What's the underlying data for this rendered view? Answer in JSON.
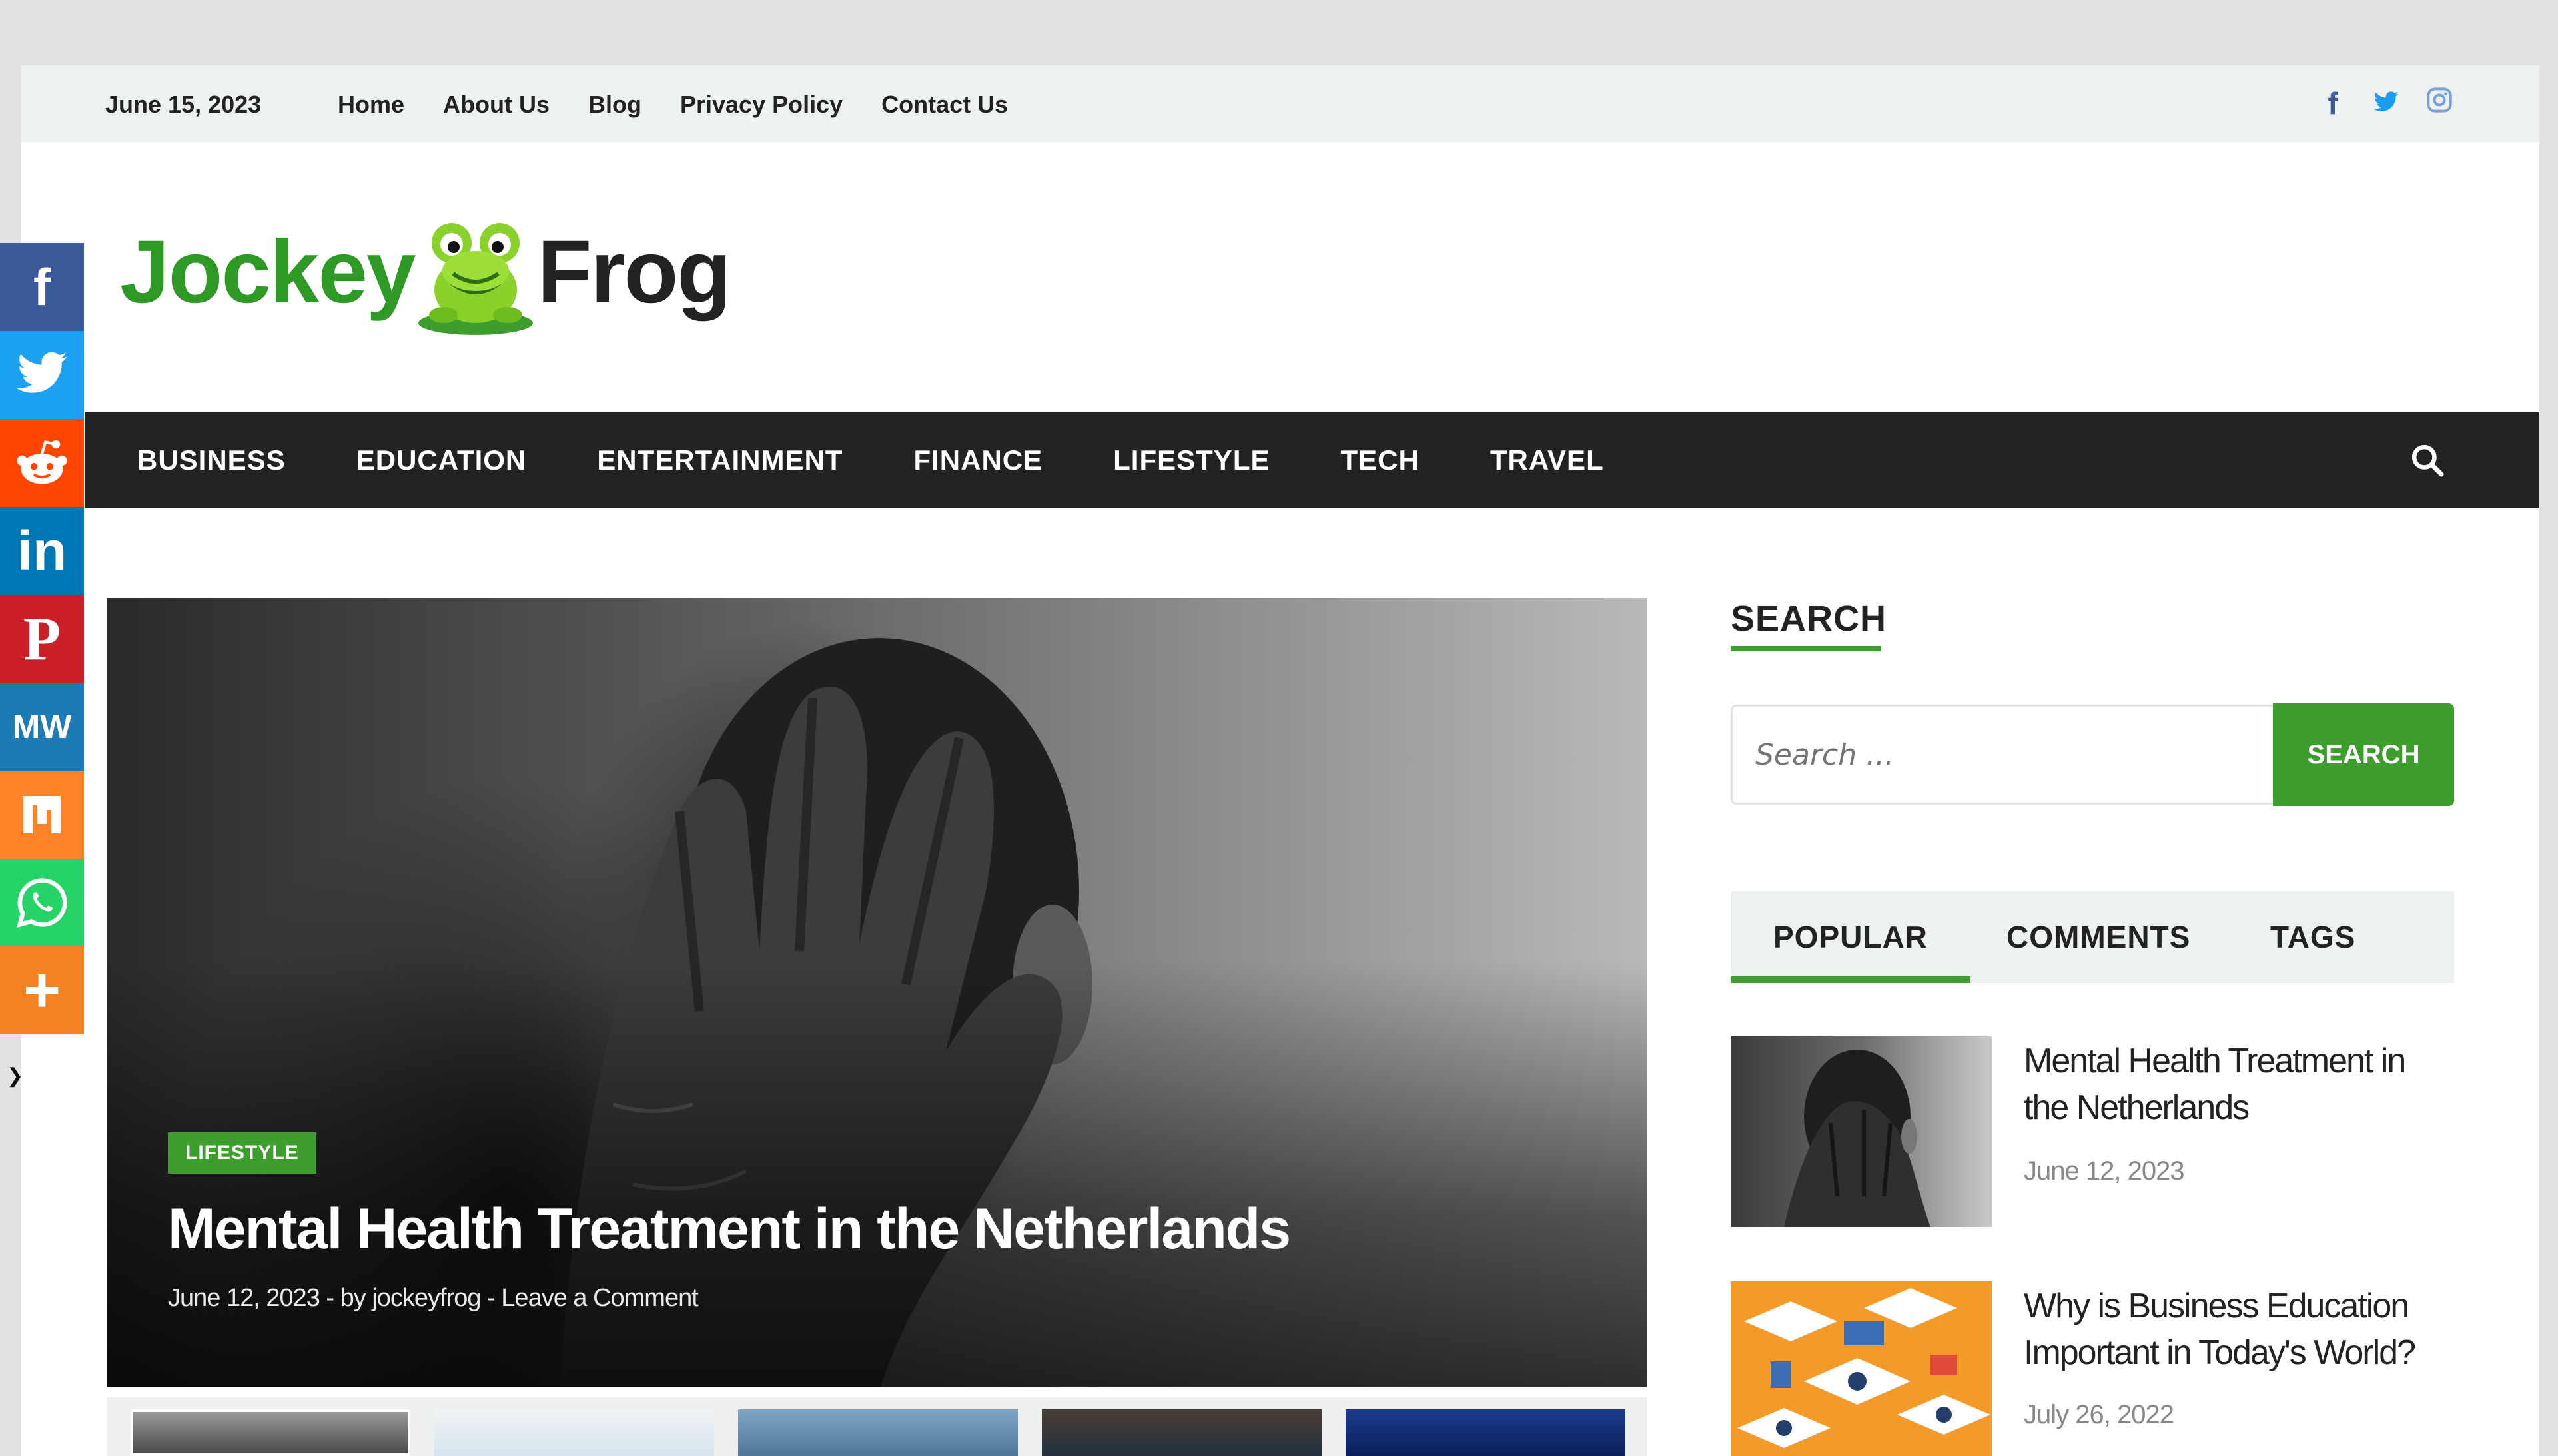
{
  "topbar": {
    "date": "June 15, 2023",
    "nav": [
      "Home",
      "About Us",
      "Blog",
      "Privacy Policy",
      "Contact Us"
    ],
    "social": [
      {
        "name": "facebook-icon",
        "glyph": "f"
      },
      {
        "name": "twitter-icon",
        "glyph": "t"
      },
      {
        "name": "instagram-icon",
        "glyph": "◎"
      }
    ]
  },
  "logo": {
    "part1": "Jockey",
    "part2": "Frog"
  },
  "mainnav": {
    "items": [
      "BUSINESS",
      "EDUCATION",
      "ENTERTAINMENT",
      "FINANCE",
      "LIFESTYLE",
      "TECH",
      "TRAVEL"
    ]
  },
  "hero": {
    "category": "LIFESTYLE",
    "title": "Mental Health Treatment in the Netherlands",
    "meta": "June 12, 2023 - by jockeyfrog - Leave a Comment"
  },
  "sidebar": {
    "search_title": "SEARCH",
    "search_placeholder": "Search ...",
    "search_button": "SEARCH",
    "tabs": [
      "POPULAR",
      "COMMENTS",
      "TAGS"
    ],
    "posts": [
      {
        "title": "Mental Health Treatment in the Netherlands",
        "date": "June 12, 2023"
      },
      {
        "title": "Why is Business Education Important in Today's World?",
        "date": "July 26, 2022"
      }
    ]
  },
  "share_bar": {
    "buttons": [
      {
        "name": "facebook-share-icon",
        "glyph": "f",
        "color": "#3b5998"
      },
      {
        "name": "twitter-share-icon",
        "glyph": "🐦",
        "color": "#1da1f2"
      },
      {
        "name": "reddit-share-icon",
        "glyph": "●",
        "color": "#ff4500"
      },
      {
        "name": "linkedin-share-icon",
        "glyph": "in",
        "color": "#0077b5"
      },
      {
        "name": "pinterest-share-icon",
        "glyph": "P",
        "color": "#cb2027"
      },
      {
        "name": "mewe-share-icon",
        "glyph": "MW",
        "color": "#1c7ab5"
      },
      {
        "name": "mix-share-icon",
        "glyph": "m",
        "color": "#ff8226"
      },
      {
        "name": "whatsapp-share-icon",
        "glyph": "✆",
        "color": "#25d366"
      },
      {
        "name": "more-share-icon",
        "glyph": "+",
        "color": "#f58220"
      }
    ],
    "hide_glyph": "❯"
  },
  "colors": {
    "brand_green": "#3d9e2e",
    "nav_dark": "#222222",
    "topbar_bg": "#eef1f2"
  }
}
